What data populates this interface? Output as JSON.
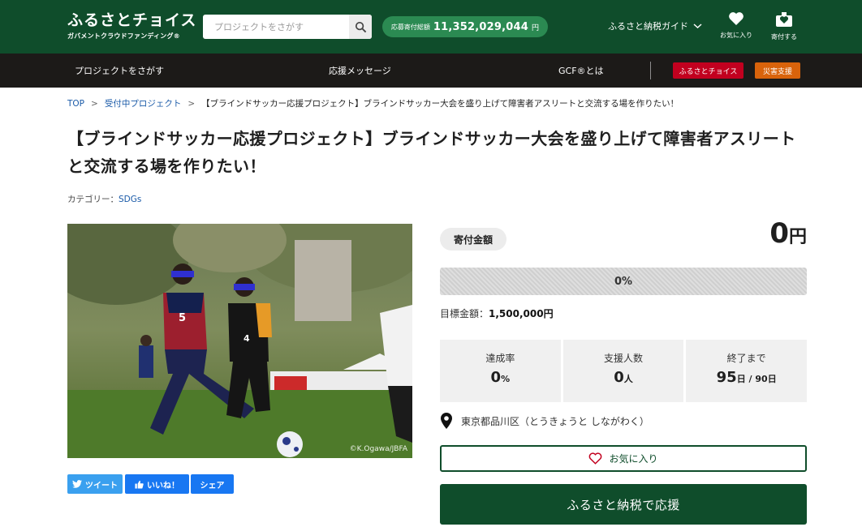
{
  "header": {
    "logo_main": "ふるさとチョイス",
    "logo_sub": "ガバメントクラウドファンディング®",
    "search_placeholder": "プロジェクトをさがす",
    "total_label": "応募寄付総額",
    "total_value": "11,352,029,044",
    "total_unit": "円",
    "guide_label": "ふるさと納税ガイド",
    "favorites_label": "お気に入り",
    "donate_label": "寄付する"
  },
  "nav": {
    "items": [
      "プロジェクトをさがす",
      "応援メッセージ",
      "GCF®とは"
    ],
    "badge_red": "ふるさとチョイス",
    "badge_orange": "災害支援"
  },
  "breadcrumb": {
    "items": [
      "TOP",
      "受付中プロジェクト",
      "【ブラインドサッカー応援プロジェクト】ブラインドサッカー大会を盛り上げて障害者アスリートと交流する場を作りたい！"
    ],
    "separator": ">"
  },
  "project": {
    "title": "【ブラインドサッカー応援プロジェクト】ブラインドサッカー大会を盛り上げて障害者アスリートと交流する場を作りたい！",
    "category_label": "カテゴリー：",
    "category_value": "SDGs",
    "photo_credit": "©K.Ogawa/JBFA"
  },
  "social": {
    "tweet": "ツイート",
    "like": "いいね！",
    "share": "シェア"
  },
  "funding": {
    "amount_label": "寄付金額",
    "amount_value": "0",
    "amount_unit": "円",
    "progress_text": "0%",
    "progress_fraction": 0,
    "goal_label": "目標金額：",
    "goal_value": "1,500,000円",
    "stats": [
      {
        "label": "達成率",
        "value": "0",
        "unit": "%"
      },
      {
        "label": "支援人数",
        "value": "0",
        "unit": "人"
      },
      {
        "label": "終了まで",
        "value": "95",
        "unit": "日 / 90日"
      }
    ],
    "location": "東京都品川区（とうきょうと しながわく）",
    "favorite_button": "お気に入り",
    "support_button": "ふるさと納税で応援"
  },
  "colors": {
    "brand_green": "#0f4d2b",
    "pill_green": "#2b8a52",
    "nav_dark": "#1c1a18",
    "badge_red": "#c2001f",
    "badge_orange": "#d9630b",
    "link_blue": "#1a5aa8"
  },
  "icons": [
    "search-icon",
    "chevron-down-icon",
    "heart-icon",
    "donate-box-icon",
    "twitter-bird-icon",
    "thumbs-up-icon",
    "map-pin-icon",
    "heart-outline-icon"
  ]
}
